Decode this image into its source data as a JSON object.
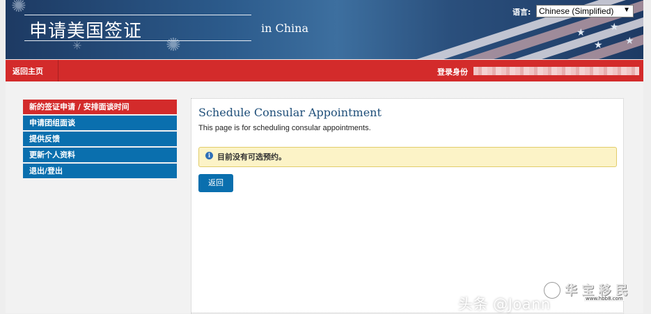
{
  "header": {
    "title": "申请美国签证",
    "subtitle": "in China",
    "language_label": "语言:",
    "language_selected": "Chinese (Simplified)"
  },
  "navbar": {
    "home_label": "返回主页",
    "login_label": "登录身份"
  },
  "sidebar": {
    "items": [
      {
        "label": "新的签证申请 / 安排面谈时间",
        "active": true
      },
      {
        "label": "申请团组面谈",
        "active": false
      },
      {
        "label": "提供反馈",
        "active": false
      },
      {
        "label": "更新个人资料",
        "active": false
      },
      {
        "label": "退出/登出",
        "active": false
      }
    ]
  },
  "main": {
    "title": "Schedule Consular Appointment",
    "description": "This page is for scheduling consular appointments.",
    "notice": "目前没有可选预约。",
    "back_label": "返回"
  },
  "watermark": {
    "text": "头条 @Joann",
    "logo_text": "华 宝 移 民",
    "logo_url": "www.hbb8.com"
  },
  "colors": {
    "nav_red": "#d32b2b",
    "sidebar_blue": "#0a6fae",
    "title_blue": "#1e4e79",
    "notice_bg": "#fcf3c7"
  }
}
